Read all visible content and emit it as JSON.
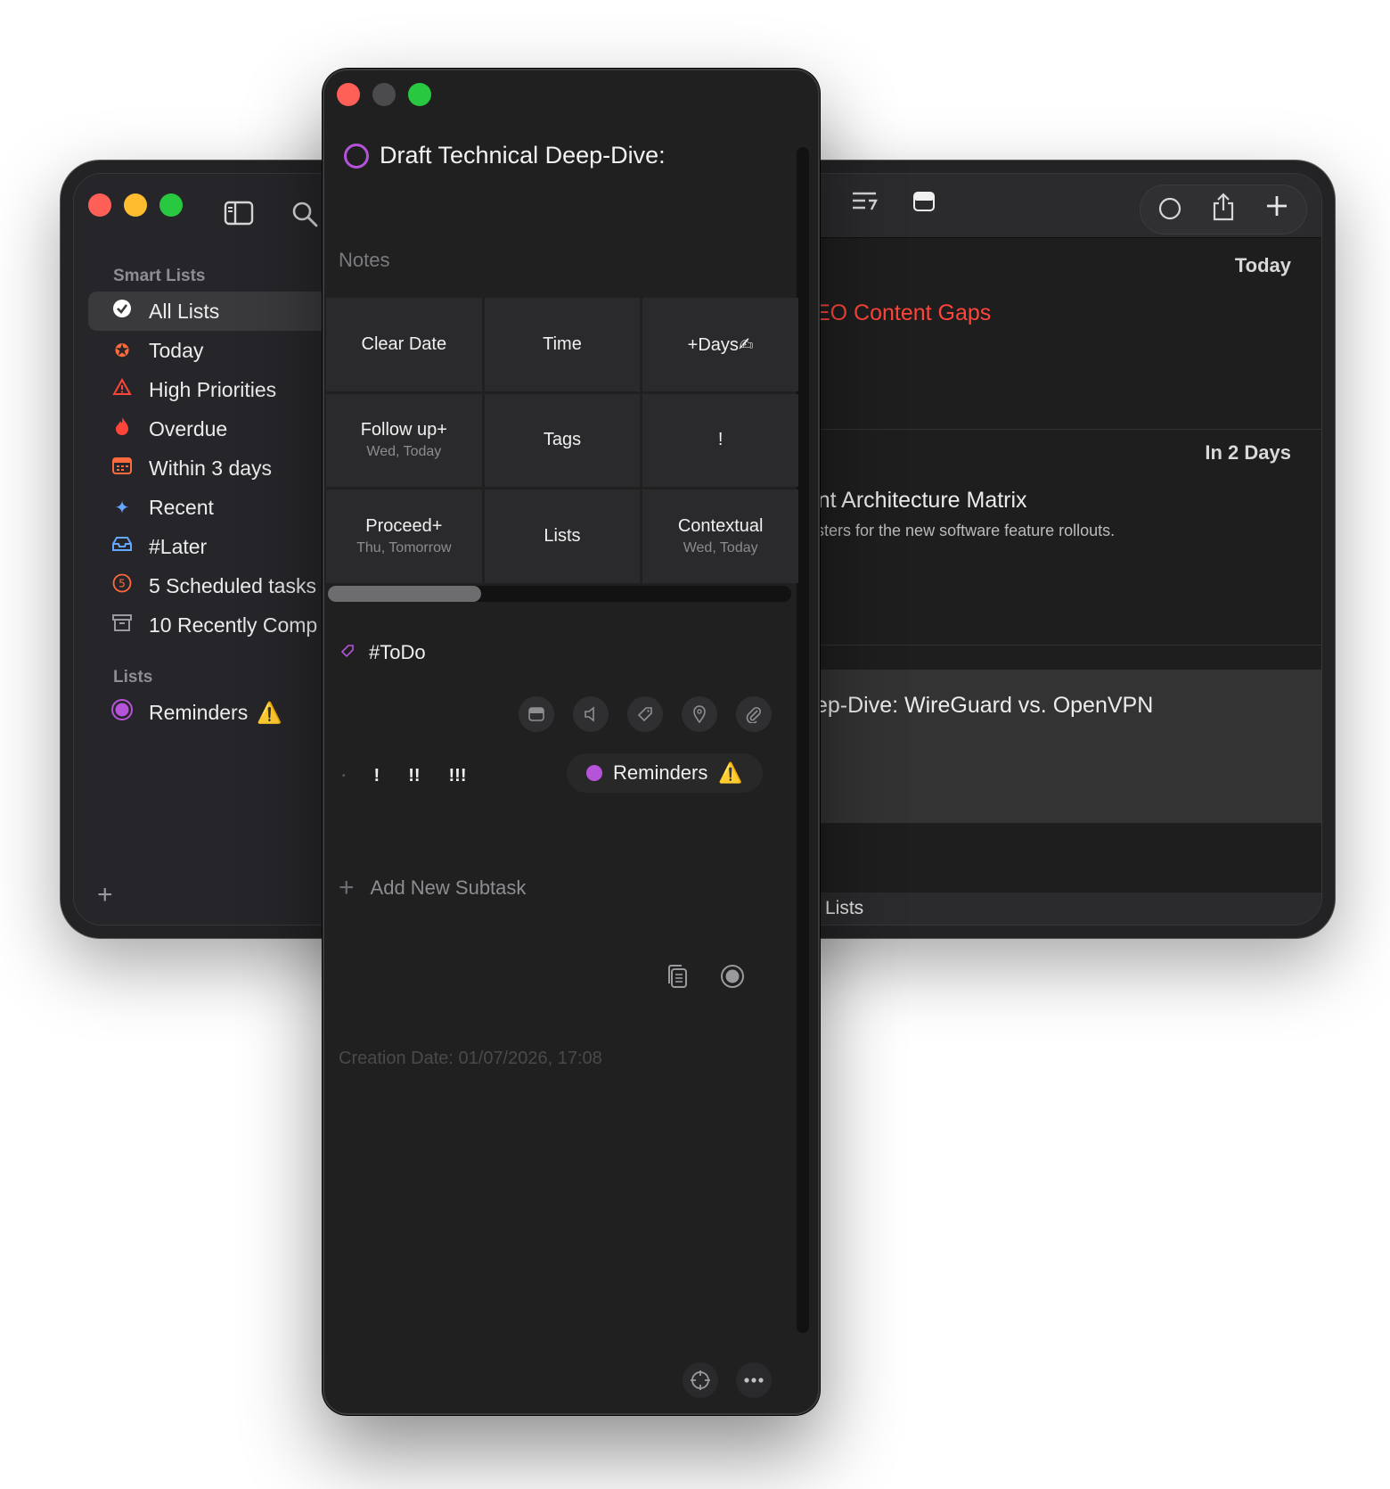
{
  "sidebar": {
    "smart_lists_header": "Smart Lists",
    "lists_header": "Lists",
    "items": [
      {
        "label": "All Lists",
        "icon": "check-circle-icon",
        "color": "#ffffff"
      },
      {
        "label": "Today",
        "icon": "star-circle-icon",
        "color": "#ff6b3d"
      },
      {
        "label": "High Priorities",
        "icon": "warning-triangle-icon",
        "color": "#ff453a"
      },
      {
        "label": "Overdue",
        "icon": "flame-icon",
        "color": "#ff453a"
      },
      {
        "label": "Within 3 days",
        "icon": "calendar-icon",
        "color": "#ff6b3d"
      },
      {
        "label": "Recent",
        "icon": "sparkle-icon",
        "color": "#64a8ff"
      },
      {
        "label": "#Later",
        "icon": "tray-icon",
        "color": "#64a8ff"
      },
      {
        "label": "5 Scheduled tasks",
        "icon": "number-five-icon",
        "color": "#ff6b3d"
      },
      {
        "label": "10 Recently Comp",
        "icon": "archive-box-icon",
        "color": "#9a9a9e"
      }
    ],
    "lists": [
      {
        "label": "Reminders",
        "warning": "⚠️",
        "color": "#b553d9"
      }
    ]
  },
  "main": {
    "sections": [
      {
        "header": "Today",
        "task_title": "r SEO Content Gaps",
        "title_color": "#ff453a",
        "warning": "⚠️"
      },
      {
        "header": "In 2 Days",
        "task_title": "ntent Architecture Matrix",
        "task_note": "t clusters for the new software feature rollouts.",
        "warning": "⚠️"
      },
      {
        "header": "",
        "task_title": "Deep-Dive: WireGuard vs. OpenVPN"
      }
    ],
    "bottom_bar": "All Lists"
  },
  "detail": {
    "title": "Draft Technical Deep-Dive:",
    "notes_placeholder": "Notes",
    "grid": [
      {
        "label": "Clear Date",
        "sub": ""
      },
      {
        "label": "Time",
        "sub": ""
      },
      {
        "label": "+Days✍",
        "sub": ""
      },
      {
        "label": "Follow up+",
        "sub": "Wed, Today"
      },
      {
        "label": "Tags",
        "sub": ""
      },
      {
        "label": "!",
        "sub": ""
      },
      {
        "label": "Proceed+",
        "sub": "Thu, Tomorrow"
      },
      {
        "label": "Lists",
        "sub": ""
      },
      {
        "label": "Contextual",
        "sub": "Wed, Today"
      }
    ],
    "tag": "#ToDo",
    "priorities": [
      "•",
      "!",
      "!!",
      "!!!"
    ],
    "list_name": "Reminders",
    "list_warning": "⚠️",
    "add_subtask": "Add New Subtask",
    "creation_date": "Creation Date: 01/07/2026, 17:08"
  },
  "colors": {
    "accent_purple": "#b553d9",
    "warning_yellow": "#f7c300",
    "overdue_red": "#ff453a"
  }
}
